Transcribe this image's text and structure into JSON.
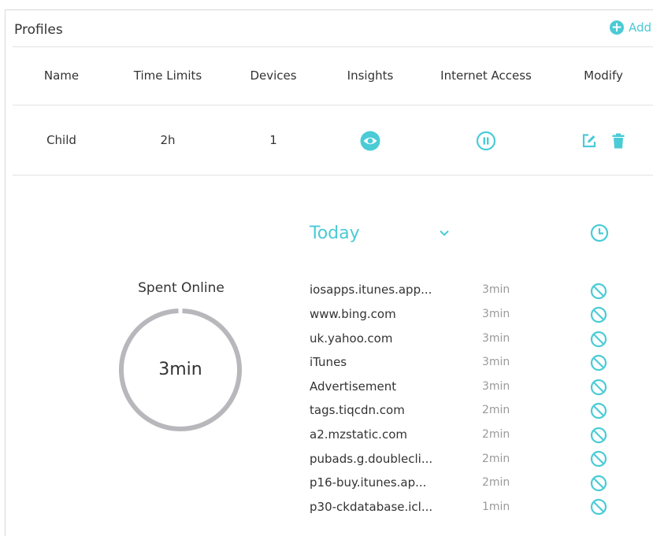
{
  "header": {
    "title": "Profiles",
    "add_label": "Add"
  },
  "table": {
    "columns": [
      "Name",
      "Time Limits",
      "Devices",
      "Insights",
      "Internet Access",
      "Modify"
    ],
    "row": {
      "name": "Child",
      "time_limit": "2h",
      "devices": "1"
    }
  },
  "insights": {
    "period": "Today",
    "spent_label": "Spent Online",
    "spent_value": "3min",
    "sites": [
      {
        "name": "iosapps.itunes.app...",
        "time": "3min"
      },
      {
        "name": "www.bing.com",
        "time": "3min"
      },
      {
        "name": "uk.yahoo.com",
        "time": "3min"
      },
      {
        "name": "iTunes",
        "time": "3min"
      },
      {
        "name": "Advertisement",
        "time": "3min"
      },
      {
        "name": "tags.tiqcdn.com",
        "time": "2min"
      },
      {
        "name": "a2.mzstatic.com",
        "time": "2min"
      },
      {
        "name": "pubads.g.doublecli...",
        "time": "2min"
      },
      {
        "name": "p16-buy.itunes.ap...",
        "time": "2min"
      },
      {
        "name": "p30-ckdatabase.icl...",
        "time": "1min"
      }
    ]
  },
  "colors": {
    "accent": "#4acbd6",
    "ring": "#b8b8bc",
    "muted": "#9a9a9a"
  },
  "icons": {
    "add": "plus-circle-icon",
    "insights": "eye-icon",
    "internet_access": "pause-circle-icon",
    "edit": "edit-icon",
    "delete": "trash-icon",
    "period_toggle": "chevron-down-icon",
    "history": "clock-icon",
    "block": "block-icon"
  }
}
